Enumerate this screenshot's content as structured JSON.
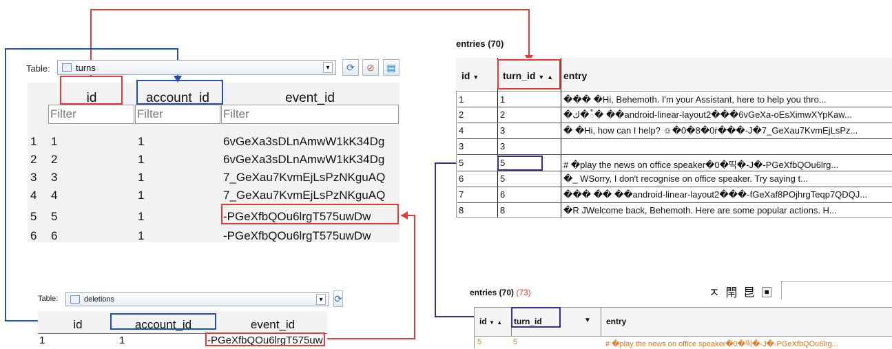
{
  "turns_panel": {
    "table_label": "Table:",
    "table_name": "turns",
    "columns": [
      "id",
      "account_id",
      "event_id"
    ],
    "filter_placeholder": "Filter",
    "rows": [
      {
        "num": "1",
        "id": "1",
        "account_id": "1",
        "event_id": "6vGeXa3sDLnAmwW1kK34Dg"
      },
      {
        "num": "2",
        "id": "2",
        "account_id": "1",
        "event_id": "6vGeXa3sDLnAmwW1kK34Dg"
      },
      {
        "num": "3",
        "id": "3",
        "account_id": "1",
        "event_id": "7_GeXau7KvmEjLsPzNKguAQ"
      },
      {
        "num": "4",
        "id": "4",
        "account_id": "1",
        "event_id": "7_GeXau7KvmEjLsPzNKguAQ"
      },
      {
        "num": "5",
        "id": "5",
        "account_id": "1",
        "event_id": "-PGeXfbQOu6lrgT575uwDw"
      },
      {
        "num": "6",
        "id": "6",
        "account_id": "1",
        "event_id": "-PGeXfbQOu6lrgT575uwDw"
      }
    ]
  },
  "deletions_panel": {
    "table_label": "Table:",
    "table_name": "deletions",
    "columns": [
      "id",
      "account_id",
      "event_id"
    ],
    "row": {
      "id": "1",
      "account_id": "1",
      "event_id": "-PGeXfbQOu6lrgT575uw"
    }
  },
  "entries_top": {
    "title": "entries (70)",
    "columns": [
      "id",
      "turn_id",
      "entry"
    ],
    "sort_desc_glyph": "▼",
    "sort_asc_glyph": "▲",
    "rows": [
      {
        "id": "1",
        "turn_id": "1",
        "entry": "��� �Hi, Behemoth. I'm your Assistant, here to help you thro..."
      },
      {
        "id": "2",
        "turn_id": "2",
        "entry": "�ك�ఄ� ��android-linear-layout2���6vGeXa-oEsXimwXYpKaw..."
      },
      {
        "id": "4",
        "turn_id": "3",
        "entry": "� �Hi, how can I help? ☺�0�8�0ṙ���-J�7_GeXau7KvmEjLsPz..."
      },
      {
        "id": "3",
        "turn_id": "3",
        "entry": ""
      },
      {
        "id": "5",
        "turn_id": "5",
        "entry": "# �play the news on office speaker�0�띡�-J�-PGeXfbQOu6lrg..."
      },
      {
        "id": "6",
        "turn_id": "5",
        "entry": "�_ WSorry, I don't recognise on office speaker. Try saying t..."
      },
      {
        "id": "7",
        "turn_id": "6",
        "entry": "��� �� ��android-linear-layout2���-fGeXaf8POjhrgTeqp7QDQJ..."
      },
      {
        "id": "8",
        "turn_id": "8",
        "entry": "�R JWelcome back, Behemoth. Here are some popular actions. H..."
      }
    ]
  },
  "entries_bottom": {
    "title": "entries (70)",
    "count_red": "(73)",
    "toolbar_glyphs": "ㅈ 閈 㫐 ▣",
    "columns": [
      "id",
      "turn_id",
      "entry"
    ],
    "row": {
      "id": "5",
      "turn_id": "5",
      "entry": "# �play the news on office speaker�0�띡�-J�-PGeXfbQOu6lrg..."
    }
  }
}
